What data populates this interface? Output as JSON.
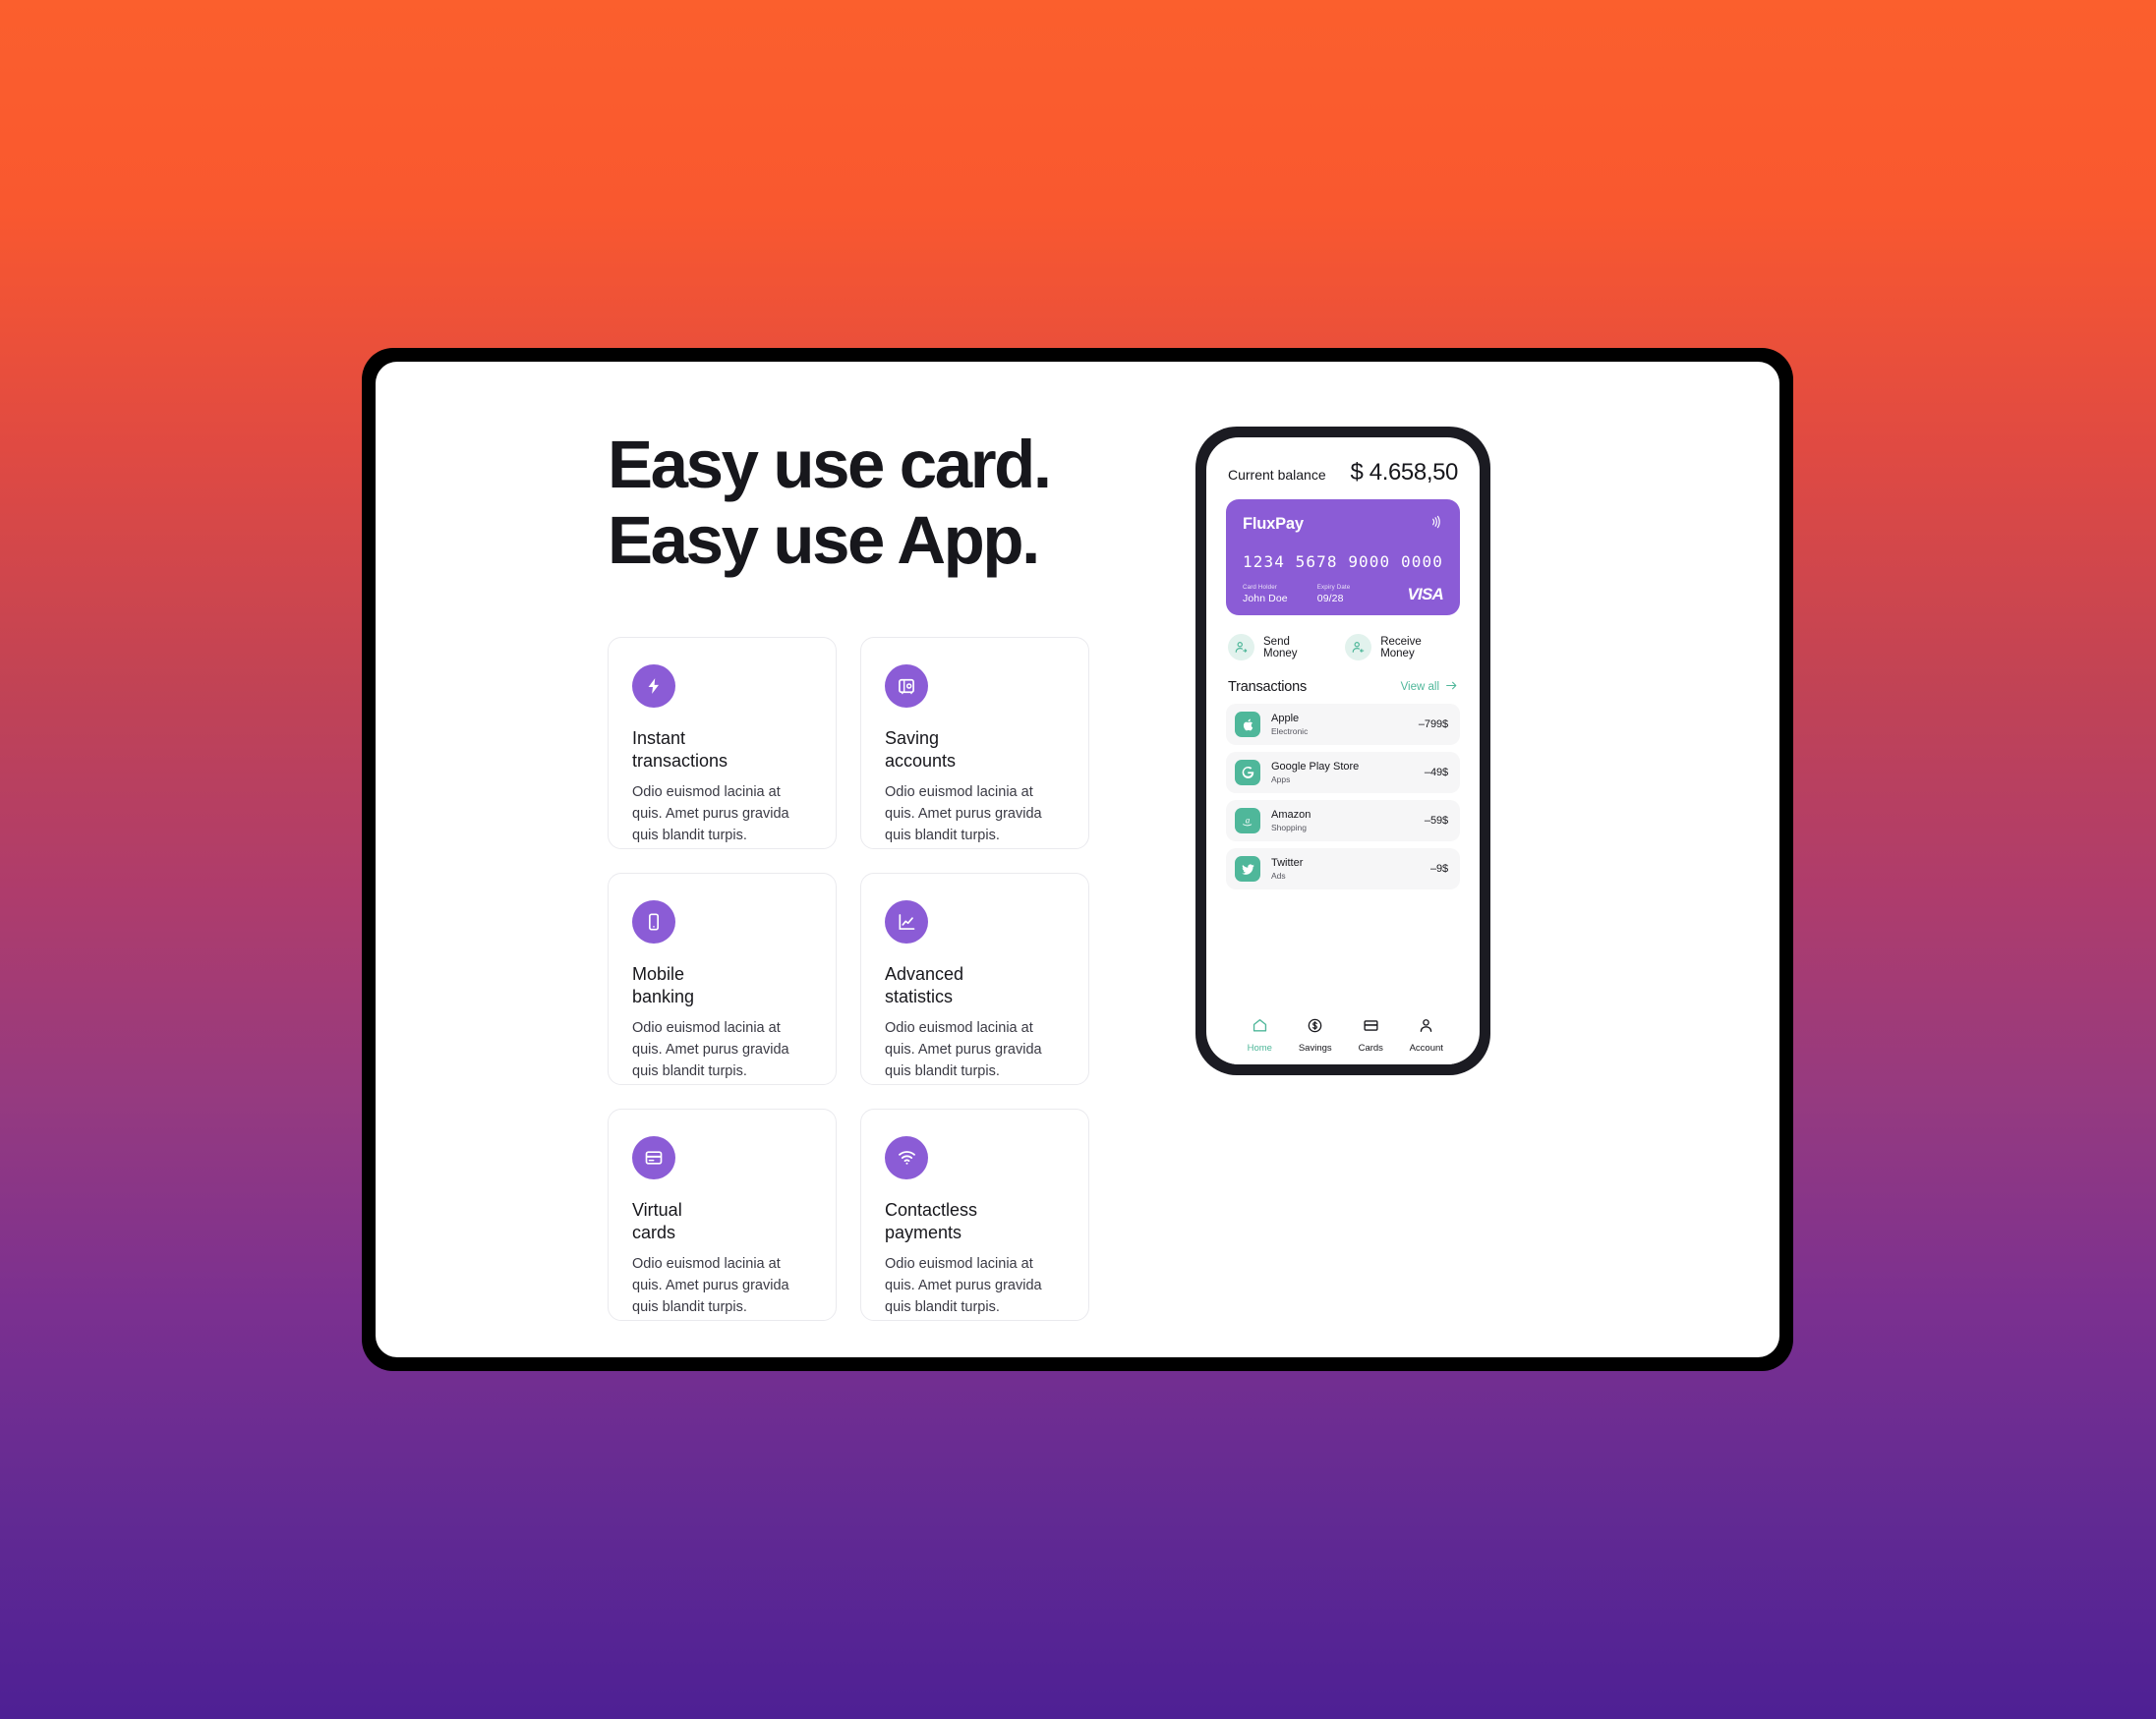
{
  "theme": {
    "accent_purple": "#8B5CD6",
    "accent_teal": "#4FB79A",
    "gradient_top": "#FB5F2D",
    "gradient_mid": "#AE3C6C",
    "gradient_bottom": "#4E2094",
    "text_dark": "#17171C",
    "card_bg": "#F6F6F7"
  },
  "hero": {
    "headline_line1": "Easy use card.",
    "headline_line2": "Easy use App."
  },
  "features": [
    {
      "icon": "bolt-icon",
      "title": "Instant\ntransactions",
      "description": "Odio euismod lacinia at quis. Amet purus gravida quis blandit turpis."
    },
    {
      "icon": "vault-icon",
      "title": "Saving\naccounts",
      "description": "Odio euismod lacinia at quis. Amet purus gravida quis blandit turpis."
    },
    {
      "icon": "smartphone-icon",
      "title": "Mobile\nbanking",
      "description": "Odio euismod lacinia at quis. Amet purus gravida quis blandit turpis."
    },
    {
      "icon": "chart-line-icon",
      "title": "Advanced\nstatistics",
      "description": "Odio euismod lacinia at quis. Amet purus gravida quis blandit turpis."
    },
    {
      "icon": "credit-card-icon",
      "title": "Virtual\ncards",
      "description": "Odio euismod lacinia at quis. Amet purus gravida quis blandit turpis."
    },
    {
      "icon": "wifi-contactless-icon",
      "title": "Contactless\npayments",
      "description": "Odio euismod lacinia at quis. Amet purus gravida quis blandit turpis."
    }
  ],
  "phone": {
    "balance": {
      "label": "Current balance",
      "value": "$ 4.658,50"
    },
    "credit_card": {
      "brand": "FluxPay",
      "number": "1234 5678 9000 0000",
      "holder_label": "Card Holder",
      "holder_value": "John Doe",
      "expiry_label": "Expiry Date",
      "expiry_value": "09/28",
      "network": "VISA",
      "contactless_icon": "contactless-waves-icon"
    },
    "actions": [
      {
        "icon": "person-send-icon",
        "label": "Send Money"
      },
      {
        "icon": "person-receive-icon",
        "label": "Receive Money"
      }
    ],
    "transactions_header": {
      "title": "Transactions",
      "view_all": "View all",
      "arrow_icon": "arrow-right-icon"
    },
    "transactions": [
      {
        "logo": "apple-icon",
        "name": "Apple",
        "category": "Electronic",
        "amount": "–799$"
      },
      {
        "logo": "google-play-icon",
        "name": "Google Play Store",
        "category": "Apps",
        "amount": "–49$"
      },
      {
        "logo": "amazon-icon",
        "name": "Amazon",
        "category": "Shopping",
        "amount": "–59$"
      },
      {
        "logo": "twitter-icon",
        "name": "Twitter",
        "category": "Ads",
        "amount": "–9$"
      }
    ],
    "nav": [
      {
        "icon": "home-icon",
        "label": "Home",
        "active": true
      },
      {
        "icon": "dollar-circle-icon",
        "label": "Savings",
        "active": false
      },
      {
        "icon": "card-icon",
        "label": "Cards",
        "active": false
      },
      {
        "icon": "person-icon",
        "label": "Account",
        "active": false
      }
    ]
  }
}
